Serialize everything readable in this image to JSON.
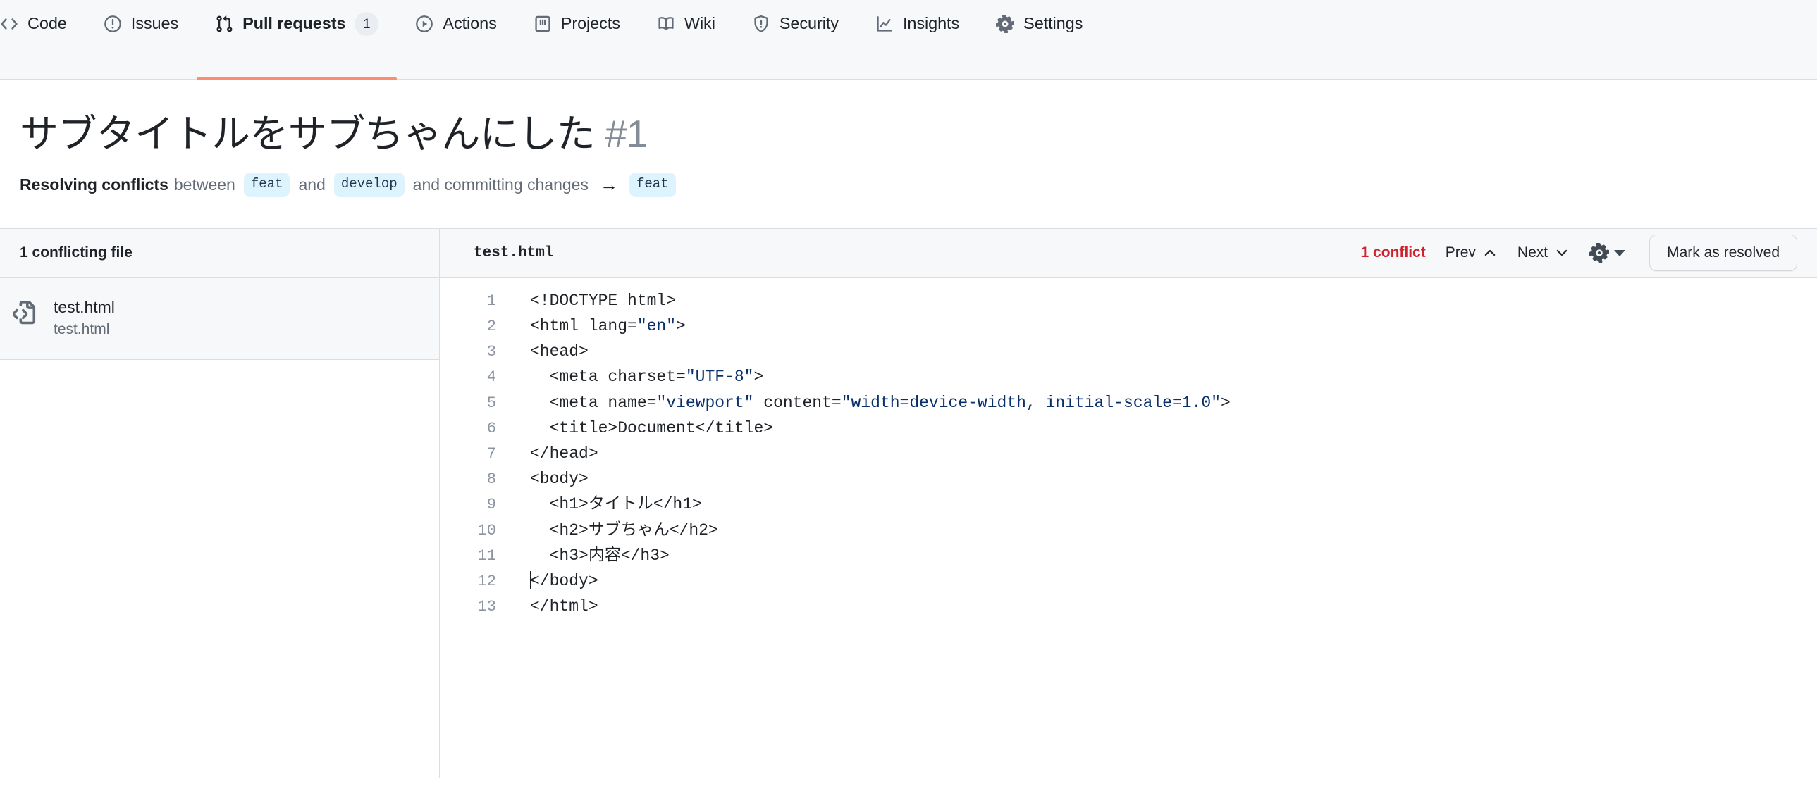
{
  "repo_nav": {
    "items": [
      {
        "label": "Code",
        "icon": "code-icon",
        "active": false,
        "counter": null
      },
      {
        "label": "Issues",
        "icon": "issue-opened-icon",
        "active": false,
        "counter": null
      },
      {
        "label": "Pull requests",
        "icon": "git-pull-request-icon",
        "active": true,
        "counter": "1"
      },
      {
        "label": "Actions",
        "icon": "play-icon",
        "active": false,
        "counter": null
      },
      {
        "label": "Projects",
        "icon": "table-icon",
        "active": false,
        "counter": null
      },
      {
        "label": "Wiki",
        "icon": "book-icon",
        "active": false,
        "counter": null
      },
      {
        "label": "Security",
        "icon": "shield-icon",
        "active": false,
        "counter": null
      },
      {
        "label": "Insights",
        "icon": "graph-icon",
        "active": false,
        "counter": null
      },
      {
        "label": "Settings",
        "icon": "gear-icon",
        "active": false,
        "counter": null
      }
    ],
    "active_underline_color": "#fd8c73"
  },
  "pr": {
    "title": "サブタイトルをサブちゃんにした",
    "number": "#1",
    "subline": {
      "lead": "Resolving conflicts",
      "between": "between",
      "branch_base": "feat",
      "and_1": "and",
      "branch_head": "develop",
      "and_2": "and committing changes",
      "arrow": "→",
      "branch_target": "feat"
    }
  },
  "sidebar": {
    "heading": "1 conflicting file",
    "files": [
      {
        "name": "test.html",
        "path": "test.html",
        "icon": "file-code-icon"
      }
    ]
  },
  "toolbar": {
    "filename": "test.html",
    "conflict_count": "1 conflict",
    "prev_label": "Prev",
    "next_label": "Next",
    "settings_icon": "gear-icon",
    "mark_resolved_label": "Mark as resolved",
    "conflict_color": "#cf222e"
  },
  "editor": {
    "lines": [
      {
        "n": "1",
        "segments": [
          {
            "t": "<!DOCTYPE html>"
          }
        ]
      },
      {
        "n": "2",
        "segments": [
          {
            "t": "<html lang="
          },
          {
            "t": "\"en\"",
            "cls": "tok-str"
          },
          {
            "t": ">"
          }
        ]
      },
      {
        "n": "3",
        "segments": [
          {
            "t": "<head>"
          }
        ]
      },
      {
        "n": "4",
        "segments": [
          {
            "t": "  <meta charset="
          },
          {
            "t": "\"UTF-8\"",
            "cls": "tok-str"
          },
          {
            "t": ">"
          }
        ]
      },
      {
        "n": "5",
        "segments": [
          {
            "t": "  <meta name="
          },
          {
            "t": "\"viewport\"",
            "cls": "tok-str"
          },
          {
            "t": " content="
          },
          {
            "t": "\"width=device-width, initial-scale=1.0\"",
            "cls": "tok-str"
          },
          {
            "t": ">"
          }
        ]
      },
      {
        "n": "6",
        "segments": [
          {
            "t": "  <title>Document</title>"
          }
        ]
      },
      {
        "n": "7",
        "segments": [
          {
            "t": "</head>"
          }
        ]
      },
      {
        "n": "8",
        "segments": [
          {
            "t": "<body>"
          }
        ]
      },
      {
        "n": "9",
        "segments": [
          {
            "t": "  <h1>タイトル</h1>"
          }
        ]
      },
      {
        "n": "10",
        "segments": [
          {
            "t": "  <h2>サブちゃん</h2>"
          }
        ]
      },
      {
        "n": "11",
        "segments": [
          {
            "t": "  <h3>内容</h3>"
          }
        ]
      },
      {
        "n": "12",
        "segments": [
          {
            "caret": true
          },
          {
            "t": "</body>"
          }
        ]
      },
      {
        "n": "13",
        "segments": [
          {
            "t": "</html>"
          }
        ]
      }
    ]
  }
}
